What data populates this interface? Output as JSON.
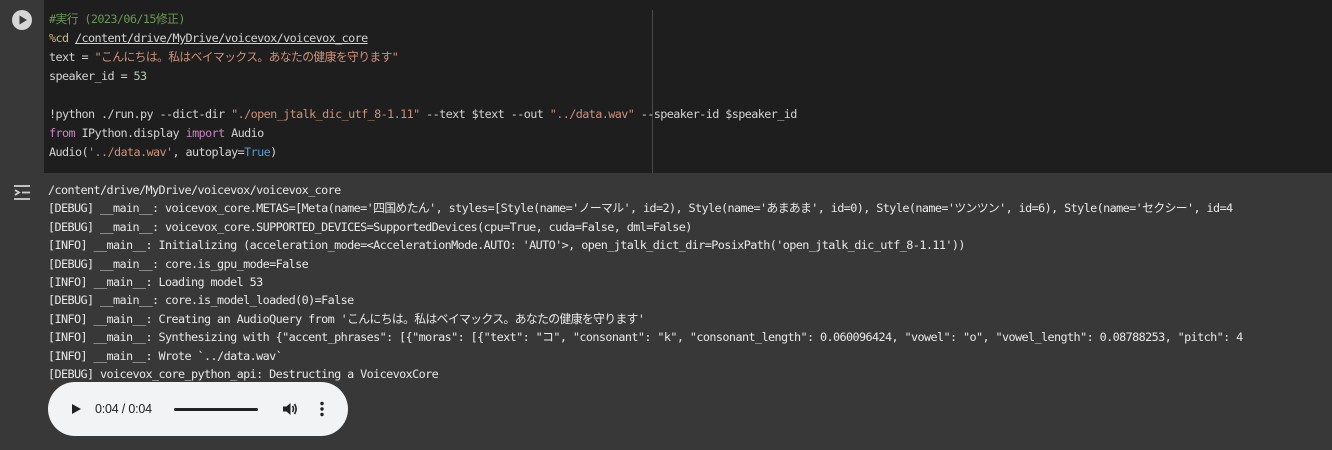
{
  "cell": {
    "code_lines": [
      [
        {
          "t": "#実行 (2023/06/15修正)",
          "c": "comment"
        }
      ],
      [
        {
          "t": "%cd ",
          "c": "magic"
        },
        {
          "t": "/content/drive/MyDrive/voicevox/voicevox_core",
          "c": "path"
        }
      ],
      [
        {
          "t": "text = ",
          "c": "id"
        },
        {
          "t": "\"こんにちは。私はベイマックス。あなたの健康を守ります\"",
          "c": "str"
        }
      ],
      [
        {
          "t": "speaker_id = ",
          "c": "id"
        },
        {
          "t": "53",
          "c": "num"
        }
      ],
      [
        {
          "t": "",
          "c": "id"
        }
      ],
      [
        {
          "t": "!python ./run.py --dict-dir ",
          "c": "id"
        },
        {
          "t": "\"./open_jtalk_dic_utf_8-1.11\"",
          "c": "str"
        },
        {
          "t": " --text $text --out ",
          "c": "id"
        },
        {
          "t": "\"../data.wav\"",
          "c": "str"
        },
        {
          "t": " --speaker-id $speaker_id",
          "c": "id"
        }
      ],
      [
        {
          "t": "from",
          "c": "kw"
        },
        {
          "t": " IPython.display ",
          "c": "id"
        },
        {
          "t": "import",
          "c": "kw"
        },
        {
          "t": " Audio",
          "c": "id"
        }
      ],
      [
        {
          "t": "Audio(",
          "c": "id"
        },
        {
          "t": "'../data.wav'",
          "c": "str"
        },
        {
          "t": ", autoplay=",
          "c": "id"
        },
        {
          "t": "True",
          "c": "const"
        },
        {
          "t": ")",
          "c": "id"
        }
      ]
    ]
  },
  "output": {
    "lines": [
      "/content/drive/MyDrive/voicevox/voicevox_core",
      "[DEBUG] __main__: voicevox_core.METAS=[Meta(name='四国めたん', styles=[Style(name='ノーマル', id=2), Style(name='あまあま', id=0), Style(name='ツンツン', id=6), Style(name='セクシー', id=4",
      "[DEBUG] __main__: voicevox_core.SUPPORTED_DEVICES=SupportedDevices(cpu=True, cuda=False, dml=False)",
      "[INFO] __main__: Initializing (acceleration_mode=<AccelerationMode.AUTO: 'AUTO'>, open_jtalk_dict_dir=PosixPath('open_jtalk_dic_utf_8-1.11'))",
      "[DEBUG] __main__: core.is_gpu_mode=False",
      "[INFO] __main__: Loading model 53",
      "[DEBUG] __main__: core.is_model_loaded(0)=False",
      "[INFO] __main__: Creating an AudioQuery from 'こんにちは。私はベイマックス。あなたの健康を守ります'",
      "[INFO] __main__: Synthesizing with {\"accent_phrases\": [{\"moras\": [{\"text\": \"コ\", \"consonant\": \"k\", \"consonant_length\": 0.060096424, \"vowel\": \"o\", \"vowel_length\": 0.08788253, \"pitch\": 4",
      "[INFO] __main__: Wrote `../data.wav`",
      "[DEBUG] voicevox_core_python_api: Destructing a VoicevoxCore"
    ]
  },
  "audio": {
    "time": "0:04 / 0:04",
    "progress_fraction": 1.0,
    "icons": [
      "play-icon",
      "volume-icon",
      "more-vert-icon"
    ]
  },
  "icons": {
    "run": "play-circle-icon",
    "output_toggle": "output-toggle-icon"
  },
  "colors": {
    "comment": "#6a9955",
    "magic": "#d7ba7d",
    "string": "#ce9178",
    "number": "#b5cea8",
    "keyword": "#c586c0",
    "constant": "#569cd6"
  }
}
